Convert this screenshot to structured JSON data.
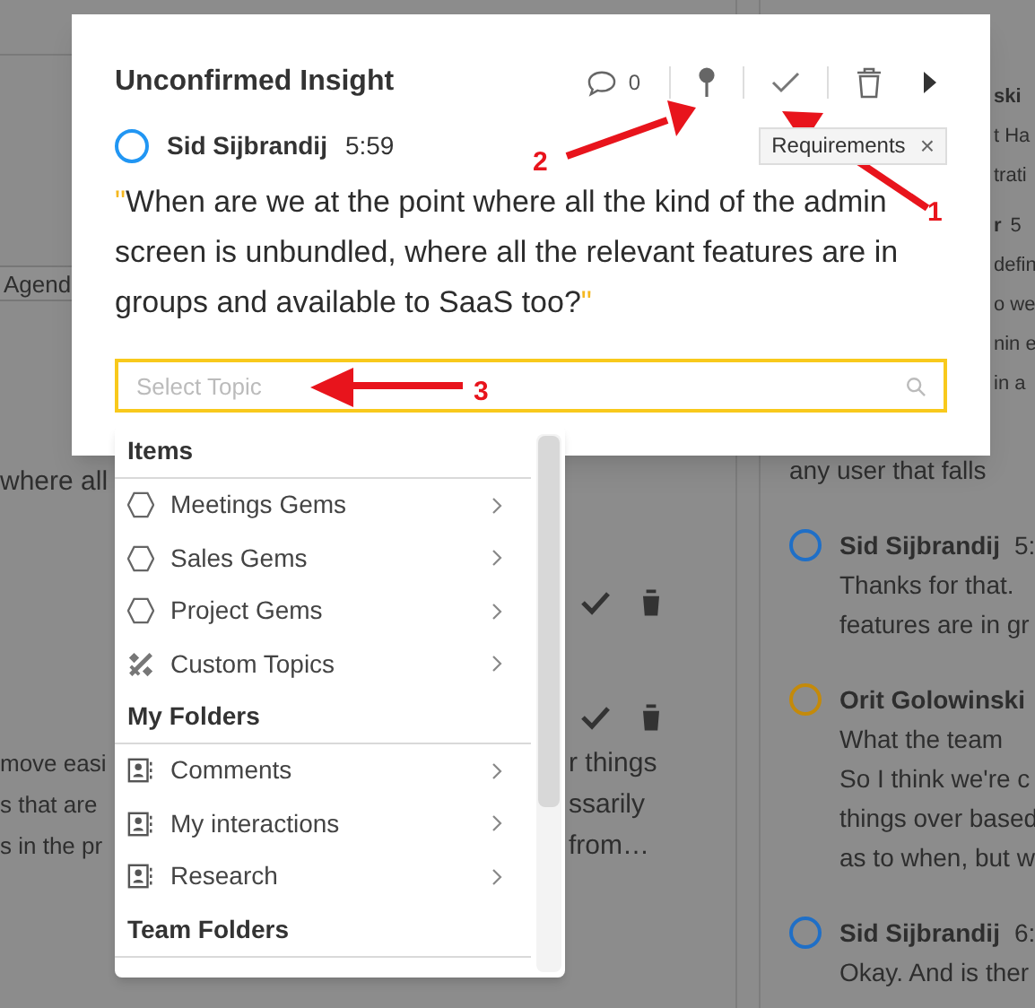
{
  "background": {
    "agenda_tag": "Agend",
    "left_line": "where all",
    "paragraph": [
      {
        "start": "move easi",
        "end": "r things"
      },
      {
        "start": "s that are",
        "end": "ssarily"
      },
      {
        "start": "s in the pr",
        "end": "from…"
      }
    ],
    "right_panel": [
      {
        "kind": "covered",
        "name": "ski",
        "lines": [
          "t Ha",
          "trati"
        ]
      },
      {
        "kind": "covered",
        "name": "r",
        "time": "5",
        "lines": [
          "defin",
          "o we",
          "nin e",
          "in a"
        ]
      },
      {
        "kind": "under",
        "lines": [
          "any user that falls"
        ]
      },
      {
        "kind": "full",
        "name": "Sid Sijbrandij",
        "time": "5:",
        "color": "#1f6fc7",
        "lines": [
          "Thanks for that.",
          "features are in gr"
        ]
      },
      {
        "kind": "full",
        "name": "Orit Golowinski",
        "color": "#c48a0a",
        "lines": [
          "What the team",
          "So I think we're c",
          "things over based",
          "as to when, but w"
        ]
      },
      {
        "kind": "full",
        "name": "Sid Sijbrandij",
        "time": "6:",
        "color": "#1f6fc7",
        "lines": [
          "Okay. And is ther"
        ]
      }
    ]
  },
  "dialog": {
    "title": "Unconfirmed Insight",
    "comment_count": "0",
    "speaker": {
      "name": "Sid Sijbrandij",
      "time": "5:59",
      "color": "#2196f3"
    },
    "tag": {
      "label": "Requirements",
      "close": "×"
    },
    "quote": {
      "open": "\"",
      "text": "When are we at the point where all the kind of the admin screen is unbundled, where all the relevant features are in groups and available to SaaS too?",
      "close": "\""
    },
    "search": {
      "placeholder": "Select Topic"
    }
  },
  "dropdown": [
    {
      "kind": "header",
      "label": "Items"
    },
    {
      "kind": "gem",
      "label": "Meetings Gems"
    },
    {
      "kind": "gem",
      "label": "Sales Gems"
    },
    {
      "kind": "gem",
      "label": "Project Gems"
    },
    {
      "kind": "custom",
      "label": "Custom Topics"
    },
    {
      "kind": "header",
      "label": "My Folders"
    },
    {
      "kind": "folder",
      "label": "Comments"
    },
    {
      "kind": "folder",
      "label": "My interactions"
    },
    {
      "kind": "folder",
      "label": "Research"
    },
    {
      "kind": "header",
      "label": "Team Folders"
    }
  ],
  "annotations": [
    {
      "label": "1"
    },
    {
      "label": "2"
    },
    {
      "label": "3"
    }
  ]
}
